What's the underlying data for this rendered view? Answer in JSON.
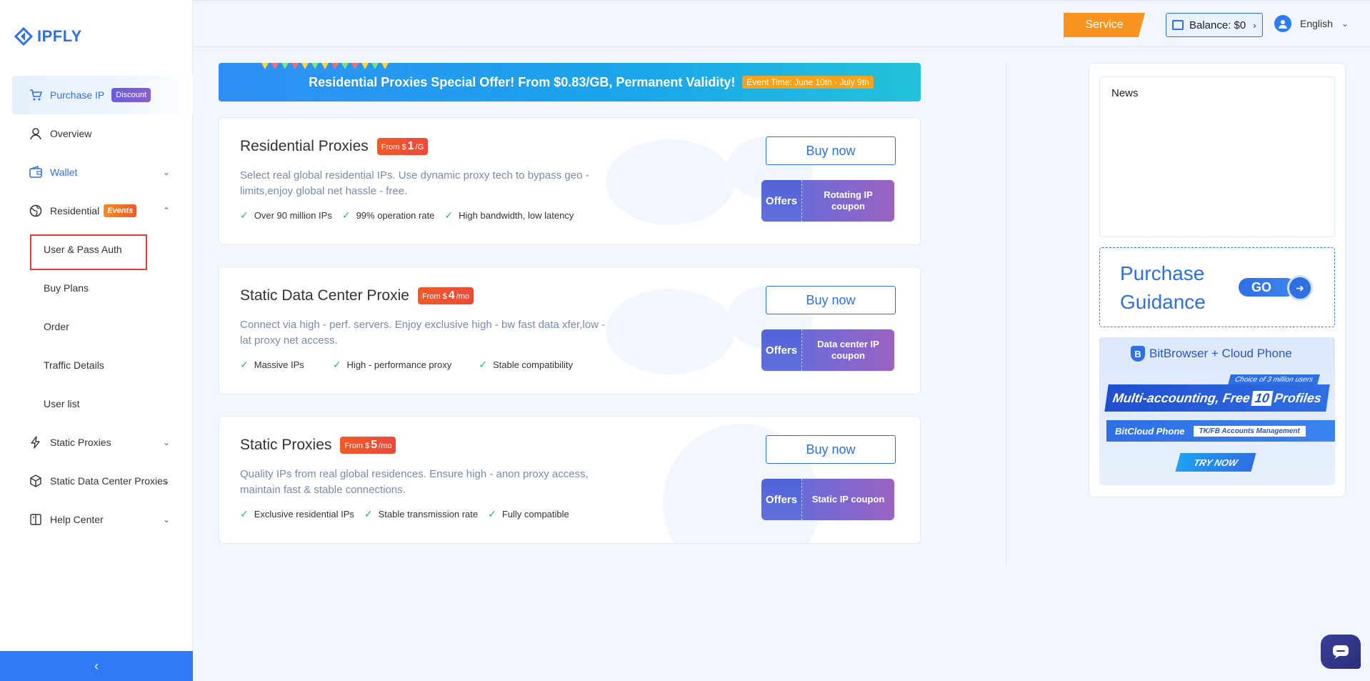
{
  "logo": {
    "text": "IPFLY"
  },
  "sidebar": {
    "items": [
      {
        "label": "Purchase IP",
        "badge": "Discount"
      },
      {
        "label": "Overview"
      },
      {
        "label": "Wallet"
      },
      {
        "label": "Residential",
        "badge": "Events"
      }
    ],
    "residential_sub": [
      "User & Pass Auth",
      "Buy Plans",
      "Order",
      "Traffic Details",
      "User list"
    ],
    "lower_items": [
      {
        "label": "Static Proxies"
      },
      {
        "label": "Static Data Center Proxies"
      },
      {
        "label": "Help Center"
      }
    ],
    "collapse_icon": "chevron-left-icon"
  },
  "header": {
    "service_label": "Service",
    "balance_label": "Balance: $0",
    "language": "English"
  },
  "banner": {
    "title": "Residential Proxies Special Offer! From $0.83/GB, Permanent Validity!",
    "event": "Event Time: June 10th - July 9th"
  },
  "products": [
    {
      "name": "Residential Proxies",
      "price_prefix": "From $",
      "price": "1",
      "price_unit": "/G",
      "desc": "Select real global residential IPs. Use dynamic proxy tech to bypass geo - limits,enjoy global net hassle - free.",
      "features": [
        "Over 90 million IPs",
        "99% operation rate",
        "High bandwidth, low latency"
      ],
      "buy_label": "Buy now",
      "offers_label": "Offers",
      "coupon_label": "Rotating IP coupon"
    },
    {
      "name": "Static Data Center Proxie",
      "price_prefix": "From $",
      "price": "4",
      "price_unit": "/mo",
      "desc": "Connect via high - perf. servers. Enjoy exclusive high - bw fast data xfer,low - lat proxy net access.",
      "features": [
        "Massive IPs",
        "High - performance proxy",
        "Stable compatibility"
      ],
      "buy_label": "Buy now",
      "offers_label": "Offers",
      "coupon_label": "Data center IP coupon"
    },
    {
      "name": "Static Proxies",
      "price_prefix": "From $",
      "price": "5",
      "price_unit": "/mo",
      "desc": "Quality IPs from real global residences. Ensure high - anon proxy access, maintain fast & stable connections.",
      "features": [
        "Exclusive residential IPs",
        "Stable transmission rate",
        "Fully compatible"
      ],
      "buy_label": "Buy now",
      "offers_label": "Offers",
      "coupon_label": "Static IP coupon"
    }
  ],
  "right": {
    "news_title": "News",
    "guidance_title": "Purchase Guidance",
    "go_label": "GO",
    "ad": {
      "brand": "BitBrowser + Cloud Phone",
      "tagline": "Choice of 3 million users",
      "headline_a": "Multi-accounting, Free ",
      "headline_num": "10",
      "headline_b": " Profiles",
      "line2": "BitCloud Phone",
      "line2_tag": "TK/FB Accounts Management",
      "cta": "TRY NOW"
    }
  },
  "colors": {
    "primary": "#2f6fe4",
    "service": "#f7931e",
    "price_tag": "#f05a28",
    "check": "#22b573"
  }
}
